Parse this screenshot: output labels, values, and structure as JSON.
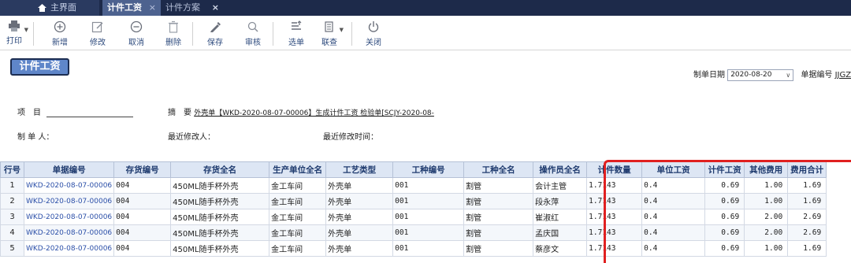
{
  "tabs": [
    {
      "label": "主界面"
    },
    {
      "label": "计件工资",
      "close": "×"
    },
    {
      "label": "计件方案",
      "close": "×"
    }
  ],
  "toolbar": {
    "print": "打印",
    "add": "新增",
    "edit": "修改",
    "cancel": "取消",
    "delete": "删除",
    "save": "保存",
    "review": "审核",
    "select": "选单",
    "linked": "联查",
    "close": "关闭"
  },
  "doc": {
    "title": "计件工资",
    "date_label": "制单日期",
    "date_value": "2020-08-20",
    "docno_label": "单据编号",
    "docno_value": "JJGZ",
    "project_label": "项　目",
    "memo_label": "摘　要",
    "memo_value": "外壳单【WKD-2020-08-07-00006】生成计件工资 检验单[SCJY-2020-08-",
    "maker_label": "制 单 人：",
    "modifier_label": "最近修改人：",
    "modtime_label": "最近修改时间："
  },
  "table": {
    "columns": [
      "行号",
      "单据编号",
      "存货编号",
      "存货全名",
      "生产单位全名",
      "工艺类型",
      "工种编号",
      "工种全名",
      "操作员全名",
      "计件数量",
      "单位工资",
      "计件工资",
      "其他费用",
      "费用合计"
    ],
    "rows": [
      [
        "1",
        "WKD-2020-08-07-00006",
        "004",
        "450ML随手杯外壳",
        "金工车间",
        "外壳单",
        "001",
        "割管",
        "会计主管",
        "1.7143",
        "0.4",
        "0.69",
        "1.00",
        "1.69"
      ],
      [
        "2",
        "WKD-2020-08-07-00006",
        "004",
        "450ML随手杯外壳",
        "金工车间",
        "外壳单",
        "001",
        "割管",
        "段永萍",
        "1.7143",
        "0.4",
        "0.69",
        "1.00",
        "1.69"
      ],
      [
        "3",
        "WKD-2020-08-07-00006",
        "004",
        "450ML随手杯外壳",
        "金工车间",
        "外壳单",
        "001",
        "割管",
        "崔淑红",
        "1.7143",
        "0.4",
        "0.69",
        "2.00",
        "2.69"
      ],
      [
        "4",
        "WKD-2020-08-07-00006",
        "004",
        "450ML随手杯外壳",
        "金工车间",
        "外壳单",
        "001",
        "割管",
        "孟庆国",
        "1.7143",
        "0.4",
        "0.69",
        "2.00",
        "2.69"
      ],
      [
        "5",
        "WKD-2020-08-07-00006",
        "004",
        "450ML随手杯外壳",
        "金工车间",
        "外壳单",
        "001",
        "割管",
        "蔡彦文",
        "1.7143",
        "0.4",
        "0.69",
        "1.00",
        "1.69"
      ]
    ]
  },
  "colors": {
    "tabbar": "#1d2a4a",
    "title_bg": "#5f86c9",
    "header_bg": "#dde6f4",
    "highlight": "#e02020"
  }
}
